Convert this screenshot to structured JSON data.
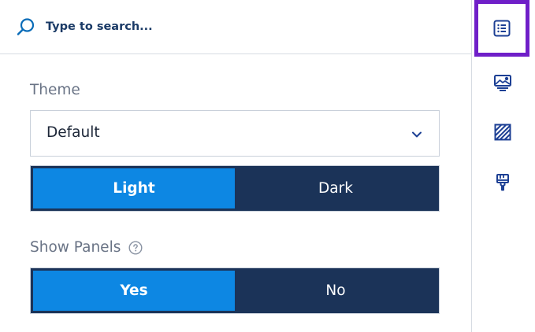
{
  "search": {
    "placeholder": "Type to search..."
  },
  "theme": {
    "label": "Theme",
    "select_value": "Default",
    "options": [
      {
        "label": "Light",
        "active": true
      },
      {
        "label": "Dark",
        "active": false
      }
    ]
  },
  "panels": {
    "label": "Show Panels",
    "options": [
      {
        "label": "Yes",
        "active": true
      },
      {
        "label": "No",
        "active": false
      }
    ]
  },
  "rail": {
    "items": [
      {
        "icon": "list-icon",
        "selected": true
      },
      {
        "icon": "image-settings-icon",
        "selected": false
      },
      {
        "icon": "pattern-icon",
        "selected": false
      },
      {
        "icon": "paint-brush-icon",
        "selected": false
      }
    ]
  },
  "colors": {
    "accent": "#0d87e3",
    "segment_bg": "#1b3358",
    "selection_outline": "#6f1fc8",
    "icon": "#1c3f94"
  }
}
